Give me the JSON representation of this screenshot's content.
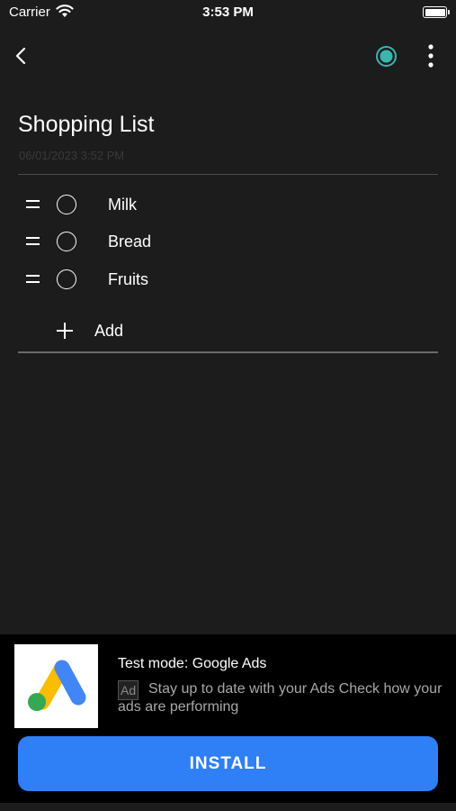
{
  "status_bar": {
    "carrier": "Carrier",
    "time": "3:53 PM"
  },
  "toolbar": {
    "back_icon": "chevron-left-icon",
    "record_icon": "radio-dot-icon",
    "record_color": "#3bb5b0",
    "more_icon": "more-vertical-icon"
  },
  "note": {
    "title": "Shopping List",
    "date": "06/01/2023 3:52 PM"
  },
  "items": [
    {
      "label": "Milk",
      "checked": false
    },
    {
      "label": "Bread",
      "checked": false
    },
    {
      "label": "Fruits",
      "checked": false
    }
  ],
  "add": {
    "label": "Add"
  },
  "ad": {
    "title": "Test mode: Google Ads",
    "badge": "Ad",
    "body": "Stay up to date with your Ads Check how your ads are performing",
    "install_label": "INSTALL",
    "button_color": "#2f7ff7"
  }
}
